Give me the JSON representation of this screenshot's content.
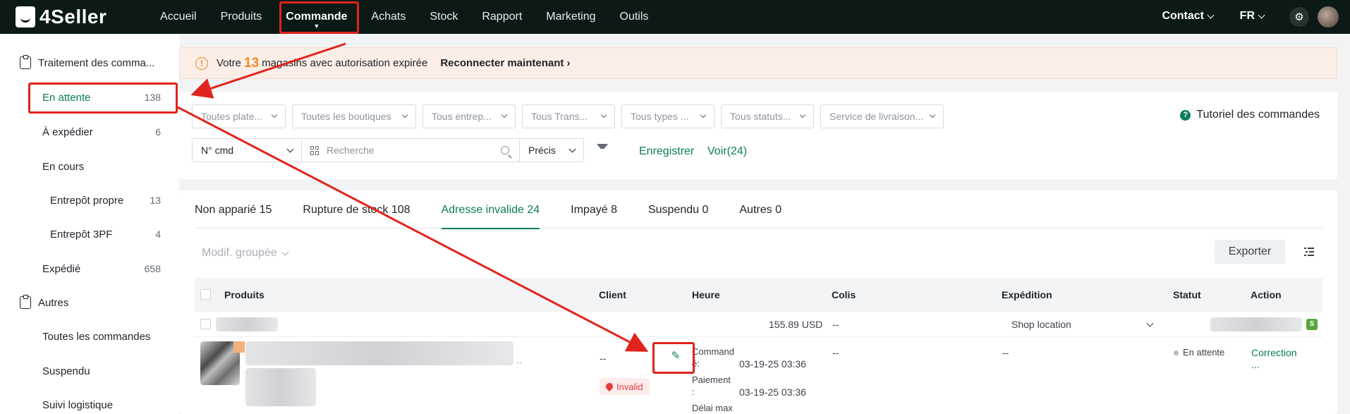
{
  "app": {
    "logo": "4Seller"
  },
  "nav": {
    "items": [
      "Accueil",
      "Produits",
      "Commande",
      "Achats",
      "Stock",
      "Rapport",
      "Marketing",
      "Outils"
    ],
    "contact": "Contact",
    "lang": "FR"
  },
  "sidebar": {
    "group1": "Traitement des comma...",
    "items": [
      {
        "label": "En attente",
        "count": "138"
      },
      {
        "label": "À expédier",
        "count": "6"
      },
      {
        "label": "En cours",
        "count": ""
      },
      {
        "label": "Entrepôt propre",
        "count": "13"
      },
      {
        "label": "Entrepôt 3PF",
        "count": "4"
      },
      {
        "label": "Expédié",
        "count": "658"
      }
    ],
    "group2": "Autres",
    "others": [
      "Toutes les commandes",
      "Suspendu",
      "Suivi logistique"
    ]
  },
  "banner": {
    "prefix": "Votre",
    "count": "13",
    "suffix": "magasins avec autorisation expirée",
    "link": "Reconnecter maintenant"
  },
  "filters": {
    "selects": [
      "Toutes plate...",
      "Toutes les boutiques",
      "Tous entrep...",
      "Tous Trans...",
      "Tous types ...",
      "Tous statuts...",
      "Service de livraison..."
    ],
    "tutorial": "Tutoriel des commandes",
    "search_field": "N° cmd",
    "search_placeholder": "Recherche",
    "match_mode": "Précis",
    "save": "Enregistrer",
    "view": "Voir(24)"
  },
  "tabs": [
    "Non apparié 15",
    "Rupture de stock 108",
    "Adresse invalide 24",
    "Impayé 8",
    "Suspendu 0",
    "Autres 0"
  ],
  "toolbar": {
    "bulk_edit": "Modif. groupée",
    "export": "Exporter"
  },
  "table": {
    "headers": [
      "Produits",
      "Client",
      "Heure",
      "Colis",
      "Expédition",
      "Statut",
      "Action"
    ],
    "row1": {
      "amount": "155.89 USD",
      "colis": "--",
      "shipping": "Shop location"
    },
    "row2": {
      "client": "--",
      "invalid": "Invalid",
      "commande_label": "Command",
      "commande_label2": "é:",
      "commande_time": "03-19-25 03:36",
      "paiement_label": "Paiement",
      "paiement_label2": ":",
      "paiement_time": "03-19-25 03:36",
      "delai_label": "Délai max",
      "colis": "--",
      "expedition": "--",
      "status": "En attente",
      "action": "Correction",
      "action_more": "...",
      "ellipsis": ".."
    }
  },
  "colors": {
    "accent": "#0a7c5c",
    "warning": "#f08a24",
    "danger": "#e23b3b",
    "annotation": "#e0231c"
  }
}
